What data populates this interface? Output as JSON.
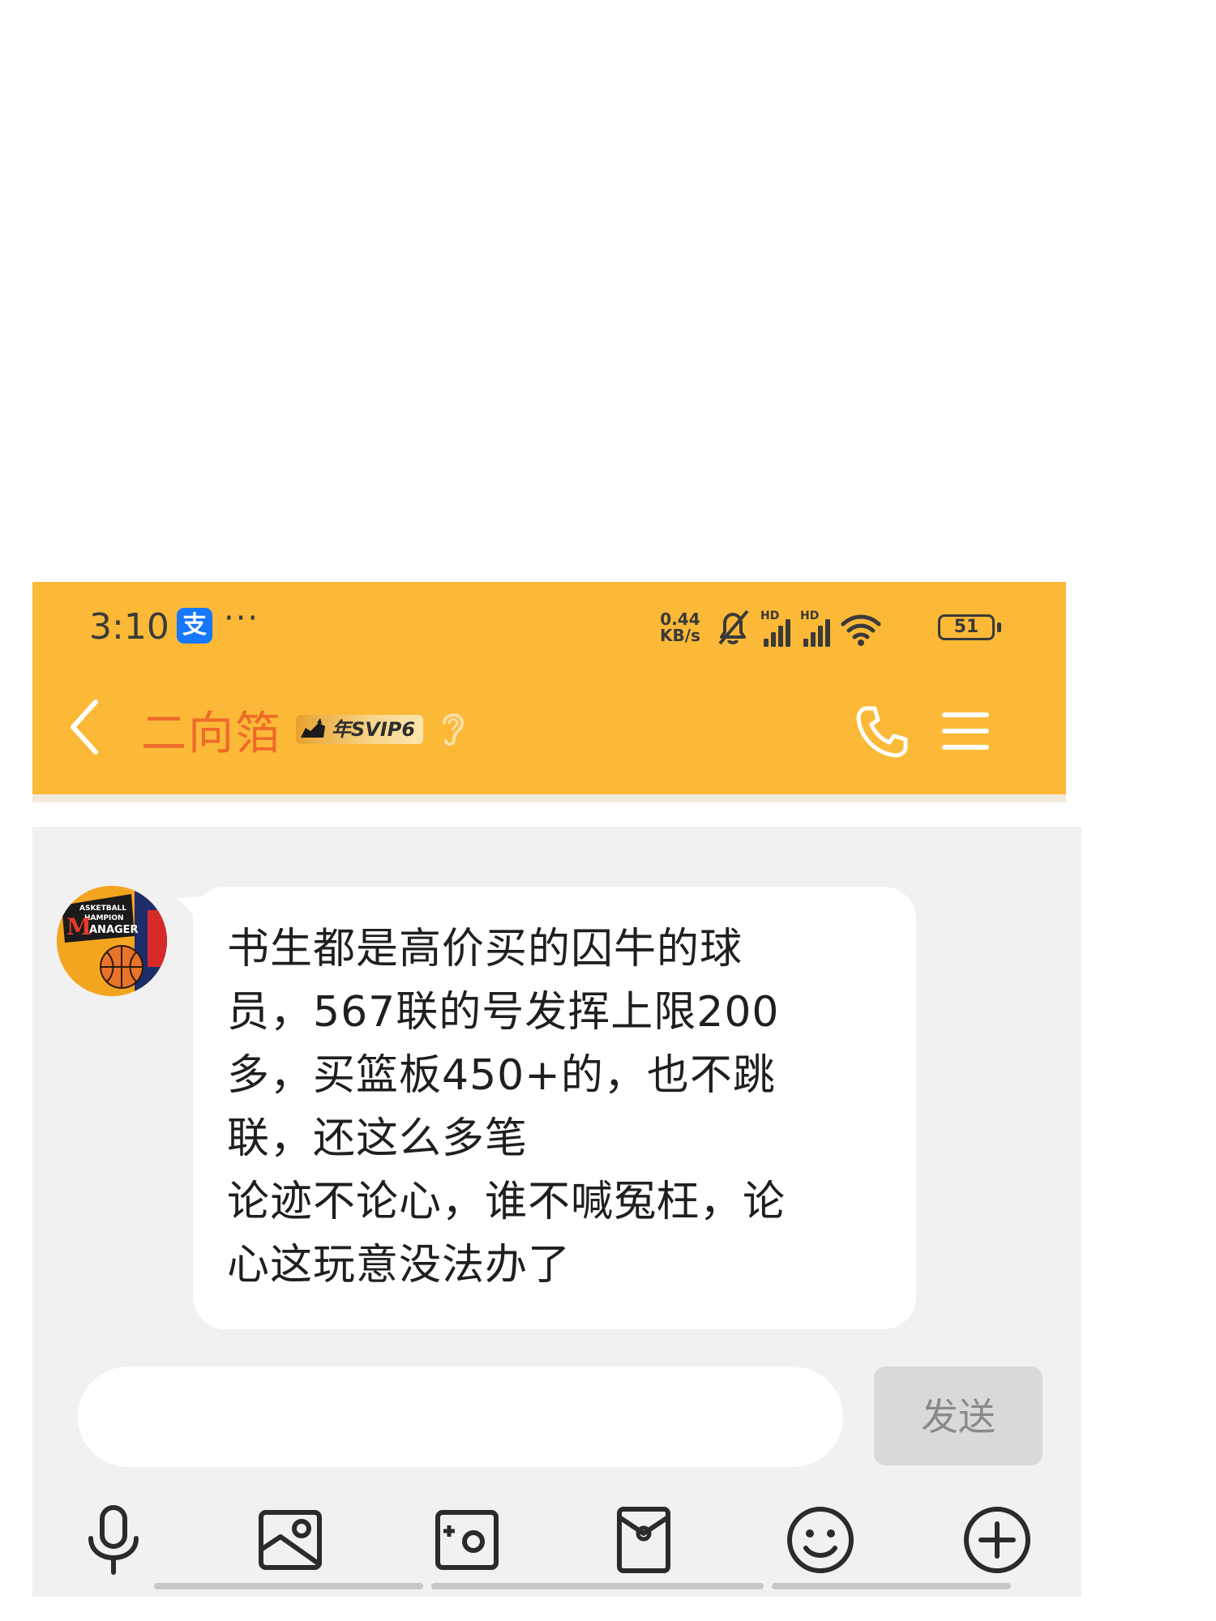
{
  "status_bar": {
    "time": "3:10",
    "app_icon": "alipay-icon",
    "app_icon_glyph": "支",
    "more_dots": "···",
    "net_speed_value": "0.44",
    "net_speed_unit": "KB/s",
    "signal_label_1": "HD",
    "signal_label_2": "HD",
    "battery_level": "51"
  },
  "header": {
    "contact_name": "二向箔",
    "badge_text": "年SVIP6"
  },
  "messages": [
    {
      "sender": "other",
      "avatar_text_1": "ASKETBALL",
      "avatar_text_2": "HAMPION",
      "avatar_text_3": "ANAGER",
      "text": "书生都是高价买的囚牛的球\n员，567联的号发挥上限200\n多，买篮板450+的，也不跳\n联，还这么多笔\n论迹不论心，谁不喊冤枉，论\n心这玩意没法办了"
    }
  ],
  "composer": {
    "input_value": "",
    "send_label": "发送"
  },
  "toolbar": {
    "items": [
      "microphone-icon",
      "picture-icon",
      "camera-icon",
      "red-packet-icon",
      "emoji-icon",
      "plus-icon"
    ]
  },
  "colors": {
    "header_bg": "#fbb937",
    "name_color": "#ef6a2a",
    "chat_bg": "#f1f1f1"
  }
}
